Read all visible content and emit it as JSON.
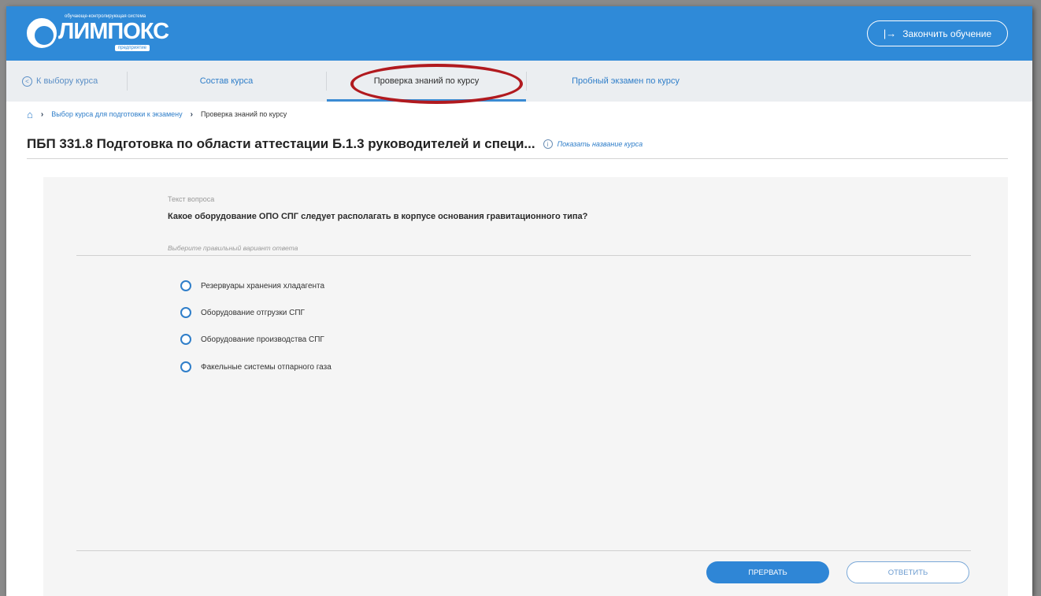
{
  "header": {
    "logo": {
      "tagline": "обучающе-контролирующая система",
      "wordmark": "ЛИМПОКС",
      "subtitle": "предприятие"
    },
    "finish_label": "Закончить обучение",
    "finish_icon": "exit-arrow-icon"
  },
  "tabs": {
    "back_label": "К выбору курса",
    "items": [
      {
        "label": "Состав курса"
      },
      {
        "label": "Проверка знаний по курсу"
      },
      {
        "label": "Пробный экзамен по курсу"
      }
    ],
    "active_index": 1
  },
  "breadcrumb": {
    "items": [
      {
        "label": "Выбор курса для подготовки к экзамену"
      },
      {
        "label": "Проверка знаний по курсу"
      }
    ]
  },
  "course": {
    "title": "ПБП 331.8 Подготовка по области аттестации Б.1.3 руководителей и специ...",
    "show_name_label": "Показать название курса"
  },
  "question": {
    "label": "Текст вопроса",
    "text": "Какое оборудование ОПО СПГ следует располагать в корпусе основания гравитационного типа?",
    "instruction": "Выберите правильный вариант ответа",
    "options": [
      {
        "label": "Резервуары хранения хладагента"
      },
      {
        "label": "Оборудование отгрузки СПГ"
      },
      {
        "label": "Оборудование производства СПГ"
      },
      {
        "label": "Факельные системы отпарного газа"
      }
    ]
  },
  "actions": {
    "interrupt_label": "ПРЕРВАТЬ",
    "answer_label": "ОТВЕТИТЬ"
  },
  "colors": {
    "header_bg": "#2f8ad8",
    "accent": "#2f7ec9",
    "highlight_ellipse": "#b11a1f"
  }
}
